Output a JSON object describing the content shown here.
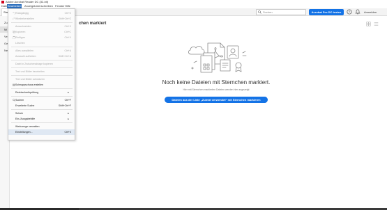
{
  "window": {
    "title": "Adobe Acrobat Reader DC (32-bit)"
  },
  "menubar": {
    "items": [
      "Datei",
      "Bearbeiten",
      "Anzeige",
      "Unterschreiben",
      "Fenster",
      "Hilfe"
    ],
    "active_index": 1
  },
  "toolbar": {
    "tab_label": "Start",
    "search_placeholder": "Suchen",
    "pro_button": "Acrobat Pro DC testen",
    "signin": "Anmelden"
  },
  "sidebar": {
    "items": [
      {
        "label": "Zu"
      },
      {
        "label": "Mi",
        "selected": true
      },
      {
        "label": "Ve"
      },
      {
        "label": "Ge"
      },
      {
        "label": "Ne"
      }
    ]
  },
  "main": {
    "heading": "chen markiert",
    "empty_title": "Noch keine Dateien mit Sternchen markiert.",
    "empty_subtitle": "Hier mit Sternchen markierten Dateien werden hier angezeigt",
    "mark_button": "Dateien aus der Liste „Zuletzt verwendet“ mit Sternchen markieren"
  },
  "edit_menu": {
    "items": [
      {
        "label": "Rückgängig",
        "shortcut": "Ctrl+Z",
        "disabled": true,
        "icon": "undo-icon"
      },
      {
        "label": "Wiederherstellen",
        "shortcut": "Shift+Ctrl+Z",
        "disabled": true,
        "icon": "redo-icon"
      },
      {
        "separator": true
      },
      {
        "label": "Ausschneiden",
        "shortcut": "Ctrl+X",
        "disabled": true
      },
      {
        "label": "Kopieren",
        "shortcut": "Ctrl+C",
        "disabled": true,
        "icon": "copy-icon"
      },
      {
        "label": "Einfügen",
        "shortcut": "Ctrl+V",
        "disabled": true,
        "icon": "paste-icon"
      },
      {
        "label": "Löschen",
        "shortcut": "",
        "disabled": true
      },
      {
        "separator": true
      },
      {
        "label": "Alles auswählen",
        "shortcut": "Ctrl+A",
        "disabled": true
      },
      {
        "label": "Auswahl aufheben",
        "shortcut": "Shift+Ctrl+A",
        "disabled": true
      },
      {
        "separator": true
      },
      {
        "label": "Datei in Zwischenablage kopieren",
        "shortcut": "",
        "disabled": true
      },
      {
        "separator": true
      },
      {
        "label": "Text und Bilder bearbeiten",
        "shortcut": "",
        "disabled": true
      },
      {
        "separator": true
      },
      {
        "label": "Text und Bilder schwärzen",
        "shortcut": "",
        "disabled": true
      },
      {
        "label": "Schnappschuss erstellen",
        "shortcut": "",
        "disabled": false,
        "icon": "camera-icon"
      },
      {
        "separator": true
      },
      {
        "label": "Rechtschreibprüfung",
        "shortcut": "",
        "disabled": false,
        "submenu": true
      },
      {
        "separator": true
      },
      {
        "label": "Suchen",
        "shortcut": "Ctrl+F",
        "disabled": false,
        "icon": "search-icon"
      },
      {
        "label": "Erweiterte Suche",
        "shortcut": "Shift+Ctrl+F",
        "disabled": false
      },
      {
        "separator": true
      },
      {
        "label": "Schutz",
        "shortcut": "",
        "disabled": false,
        "submenu": true
      },
      {
        "label": "Ein-/Ausgabehilfe",
        "shortcut": "",
        "disabled": false,
        "submenu": true
      },
      {
        "separator": true
      },
      {
        "label": "Werkzeuge verwalten",
        "shortcut": "",
        "disabled": false
      },
      {
        "label": "Einstellungen...",
        "shortcut": "Ctrl+K",
        "disabled": false,
        "highlighted": true
      }
    ]
  },
  "colors": {
    "accent": "#1473e6",
    "menu_active": "#2a6ebd",
    "illustration_stroke": "#8a8a8a"
  }
}
